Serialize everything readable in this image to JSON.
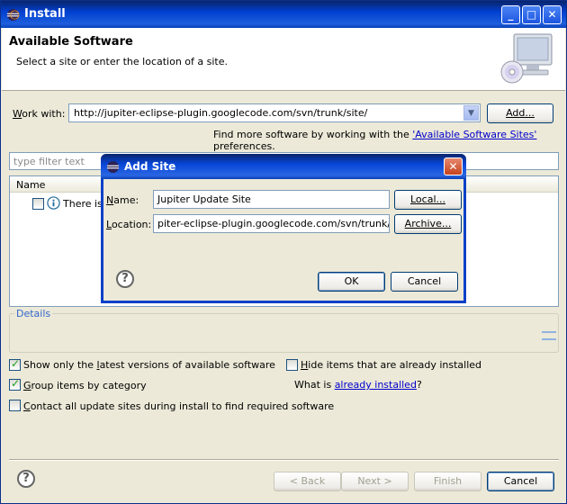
{
  "window": {
    "title": "Install",
    "minimize": "_",
    "maximize": "□",
    "close": "✕"
  },
  "banner": {
    "title": "Available Software",
    "subtitle": "Select a site or enter the location of a site."
  },
  "work_with": {
    "label_pre": "",
    "label_u": "W",
    "label_post": "ork with:",
    "value": "http://jupiter-eclipse-plugin.googlecode.com/svn/trunk/site/",
    "add_button": "Add..."
  },
  "find_more": {
    "pre": "Find more software by working with the ",
    "link": "'Available Software Sites'",
    "post": " preferences."
  },
  "filter": {
    "placeholder": "type filter text"
  },
  "tree": {
    "header": "Name",
    "row_text": "There is"
  },
  "details": {
    "legend": "Details"
  },
  "options": {
    "latest": {
      "pre": "Show only the ",
      "u": "l",
      "post": "atest versions of available software",
      "checked": true
    },
    "group": {
      "pre": "",
      "u": "G",
      "post": "roup items by category",
      "checked": true
    },
    "contact": {
      "pre": "",
      "u": "C",
      "post": "ontact all update sites during install to find required software",
      "checked": false
    },
    "hide": {
      "pre": "",
      "u": "H",
      "post": "ide items that are already installed",
      "checked": false
    },
    "already": {
      "pre": "What is ",
      "link": "already installed",
      "post": "?"
    }
  },
  "footer": {
    "back": "< Back",
    "next": "Next >",
    "finish": "Finish",
    "cancel": "Cancel"
  },
  "dialog": {
    "title": "Add Site",
    "name_label_u": "N",
    "name_label_post": "ame:",
    "name_value": "Jupiter Update Site",
    "local_button": "Local...",
    "location_label_u": "L",
    "location_label_post": "ocation:",
    "location_value": "piter-eclipse-plugin.googlecode.com/svn/trunk/site/",
    "archive_button": "Archive...",
    "ok": "OK",
    "cancel": "Cancel"
  },
  "colors": {
    "titlebar": "#0040d0",
    "link": "#0000cc",
    "details_legend": "#3366cc"
  }
}
